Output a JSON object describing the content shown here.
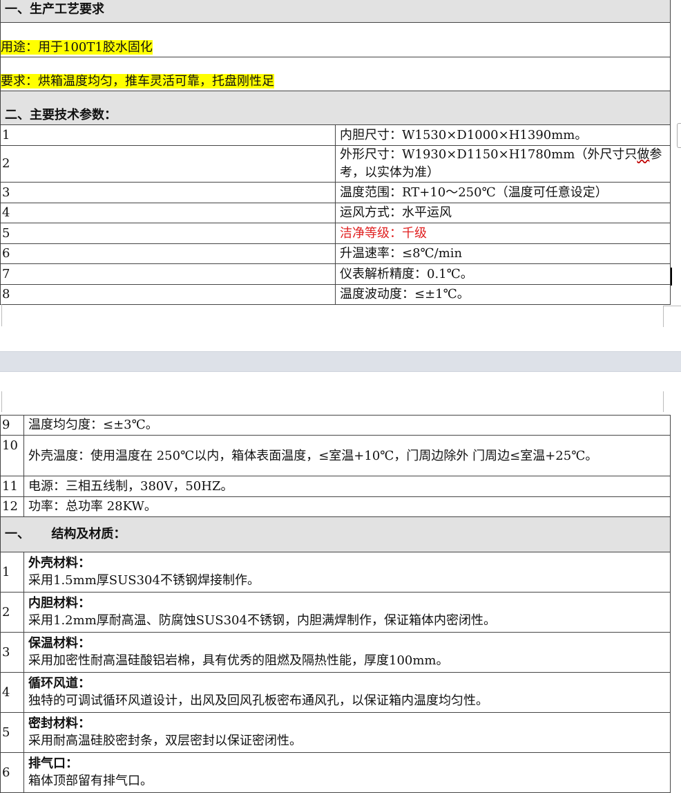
{
  "page1": {
    "section1_title": "一、生产工艺要求",
    "usage": "用途：用于100T1胶水固化",
    "requirement": "要求：烘箱温度均匀，推车灵活可靠，托盘刚性足",
    "section2_title": "二、主要技术参数：",
    "params": [
      {
        "no": "1",
        "text": "内胆尺寸：W1530×D1000×H1390mm。"
      },
      {
        "no": "2",
        "text_a": "外形尺寸：W1930×D1150×H1780mm（外尺寸只",
        "text_b": "做",
        "text_c": "参考，以实体为准）"
      },
      {
        "no": "3",
        "text": "温度范围：RT+10～250℃（温度可任意设定）"
      },
      {
        "no": "4",
        "text": "运风方式：水平运风"
      },
      {
        "no": "5",
        "text": "洁净等级：千级"
      },
      {
        "no": "6",
        "text": "升温速率：≤8℃/min"
      },
      {
        "no": "7",
        "text": "仪表解析精度：0.1℃。"
      },
      {
        "no": "8",
        "text": "温度波动度：≤±1℃。"
      }
    ]
  },
  "page2": {
    "params": [
      {
        "no": "9",
        "text": "温度均匀度：≤±3℃。"
      },
      {
        "no": "10",
        "text": "外壳温度：使用温度在 250℃以内，箱体表面温度，≤室温+10℃，门周边除外    门周边≤室温+25℃。"
      },
      {
        "no": "11",
        "text": "电源：三相五线制，380V，50HZ。"
      },
      {
        "no": "12",
        "text": "功率：总功率 28KW。"
      }
    ],
    "section3_title": "一、     结构及材质：",
    "materials": [
      {
        "no": "1",
        "label": "外壳材料：",
        "desc": "采用1.5mm厚SUS304不锈钢焊接制作。"
      },
      {
        "no": "2",
        "label": "内胆材料：",
        "desc": "采用1.2mm厚耐高温、防腐蚀SUS304不锈钢，内胆满焊制作，保证箱体内密闭性。"
      },
      {
        "no": "3",
        "label": "保温材料：",
        "desc": "采用加密性耐高温硅酸铝岩棉，具有优秀的阻燃及隔热性能，厚度100mm。"
      },
      {
        "no": "4",
        "label": "循环风道：",
        "desc": "独特的可调试循环风道设计，出风及回风孔板密布通风孔，以保证箱内温度均匀性。"
      },
      {
        "no": "5",
        "label": "密封材料：",
        "desc": "采用耐高温硅胶密封条，双层密封以保证密闭性。"
      },
      {
        "no": "6",
        "label": "排气口：",
        "desc": "箱体顶部留有排气口。"
      }
    ]
  },
  "colors": {
    "header_bg": "#e2e2e2",
    "highlight": "#ffff00",
    "red_text": "#e02020",
    "page_gap": "#dde1e8"
  }
}
